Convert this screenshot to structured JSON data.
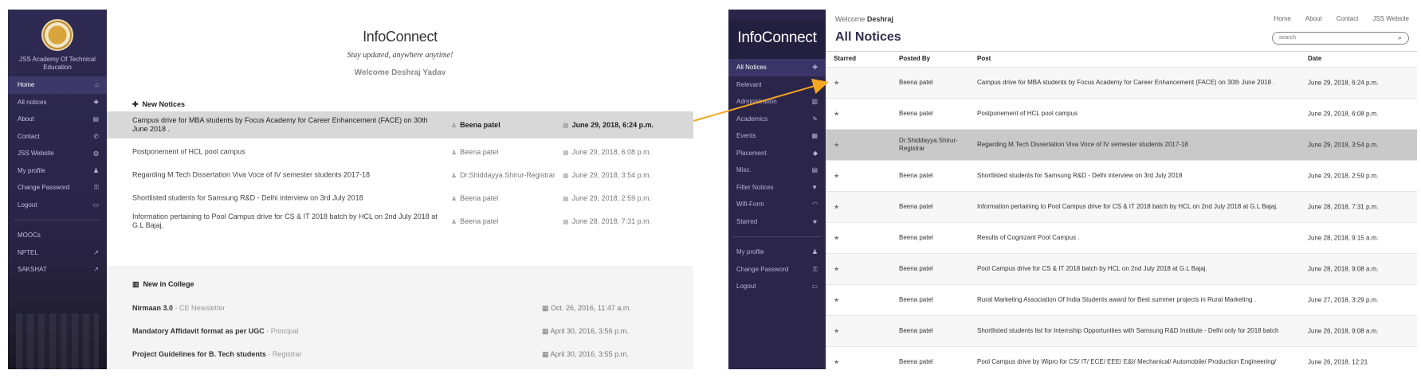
{
  "left": {
    "college_name": "JSS Academy Of Technical Education",
    "nav": [
      {
        "label": "Home",
        "icon": "home-icon",
        "glyph": "⌂",
        "active": true
      },
      {
        "label": "All notices",
        "icon": "pin-icon",
        "glyph": "✚",
        "active": false
      },
      {
        "label": "About",
        "icon": "card-icon",
        "glyph": "▤",
        "active": false
      },
      {
        "label": "Contact",
        "icon": "phone-icon",
        "glyph": "✆",
        "active": false
      },
      {
        "label": "JSS Website",
        "icon": "globe-icon",
        "glyph": "◍",
        "active": false
      },
      {
        "label": "My profile",
        "icon": "user-icon",
        "glyph": "♟",
        "active": false
      },
      {
        "label": "Change Password",
        "icon": "key-icon",
        "glyph": "⚿",
        "active": false
      },
      {
        "label": "Logout",
        "icon": "inbox-icon",
        "glyph": "▭",
        "active": false
      }
    ],
    "nav_ext": [
      {
        "label": "MOOCs",
        "icon": "",
        "glyph": ""
      },
      {
        "label": "NPTEL",
        "icon": "external-link-icon",
        "glyph": "↗"
      },
      {
        "label": "SAKSHAT",
        "icon": "external-link-icon",
        "glyph": "↗"
      }
    ],
    "brand": "InfoConnect",
    "tagline": "Stay updated, anywhere anytime!",
    "welcome": "Welcome Deshraj Yadav",
    "new_notices_title": "New Notices",
    "notices": [
      {
        "post": "Campus drive for MBA students by Focus Academy for Career Enhancement (FACE) on 30th June 2018 .",
        "by": "Beena patel",
        "date": "June 29, 2018, 6:24 p.m.",
        "highlight": true
      },
      {
        "post": "Postponement of HCL pool campus",
        "by": "Beena patel",
        "date": "June 29, 2018, 6:08 p.m.",
        "highlight": false
      },
      {
        "post": "Regarding M.Tech Dissertation Viva Voce of IV semester students 2017-18",
        "by": "Dr.Shiddayya.Shirur-Registrar",
        "date": "June 29, 2018, 3:54 p.m.",
        "highlight": false
      },
      {
        "post": "Shortlisted students for Samsung R&D - Delhi interview on 3rd July 2018",
        "by": "Beena patel",
        "date": "June 29, 2018, 2:59 p.m.",
        "highlight": false
      },
      {
        "post": "Information pertaining to Pool Campus drive for CS & IT 2018 batch by HCL on 2nd July 2018 at G.L Bajaj.",
        "by": "Beena patel",
        "date": "June 28, 2018, 7:31 p.m.",
        "highlight": false
      }
    ],
    "college_title": "New in College",
    "college_items": [
      {
        "title": "Nirmaan 3.0",
        "sep": " - ",
        "source": "CE Newsletter",
        "date": "Oct. 26, 2016, 11:47 a.m."
      },
      {
        "title": "Mandatory Affidavit format as per UGC",
        "sep": " - ",
        "source": "Principal",
        "date": "April 30, 2016, 3:56 p.m."
      },
      {
        "title": "Project Guidelines for B. Tech students",
        "sep": " - ",
        "source": "Registrar",
        "date": "April 30, 2016, 3:55 p.m."
      }
    ]
  },
  "right": {
    "brand": "InfoConnect",
    "nav": [
      {
        "label": "All Notices",
        "icon": "pin-icon",
        "glyph": "✚",
        "active": true
      },
      {
        "label": "Relevant",
        "icon": "tag-icon",
        "glyph": "◈",
        "active": false
      },
      {
        "label": "Administration",
        "icon": "bank-icon",
        "glyph": "▥",
        "active": false
      },
      {
        "label": "Academics",
        "icon": "edit-icon",
        "glyph": "✎",
        "active": false
      },
      {
        "label": "Events",
        "icon": "calendar-icon",
        "glyph": "▦",
        "active": false
      },
      {
        "label": "Placement",
        "icon": "graduation-cap-icon",
        "glyph": "◆",
        "active": false
      },
      {
        "label": "Misc.",
        "icon": "list-icon",
        "glyph": "▤",
        "active": false
      },
      {
        "label": "Filter Notices",
        "icon": "filter-icon",
        "glyph": "▼",
        "active": false
      },
      {
        "label": "Wifi-Form",
        "icon": "wifi-icon",
        "glyph": "◠",
        "active": false
      },
      {
        "label": "Starred",
        "icon": "star-icon",
        "glyph": "★",
        "active": false
      }
    ],
    "nav2": [
      {
        "label": "My profile",
        "icon": "user-icon",
        "glyph": "♟"
      },
      {
        "label": "Change Password",
        "icon": "key-icon",
        "glyph": "⚿"
      },
      {
        "label": "Logout",
        "icon": "inbox-icon",
        "glyph": "▭"
      }
    ],
    "welcome_prefix": "Welcome ",
    "welcome_name": "Deshraj",
    "topnav": [
      "Home",
      "About",
      "Contact",
      "JSS Website"
    ],
    "page_title": "All Notices",
    "search_placeholder": "search",
    "columns": [
      "Starred",
      "Posted By",
      "Post",
      "Date"
    ],
    "rows": [
      {
        "by": "Beena patel",
        "post": "Campus drive for MBA students by Focus Academy for Career Enhancement (FACE) on 30th June 2018 .",
        "date": "June 29, 2018, 6:24 p.m.",
        "style": "alt"
      },
      {
        "by": "Beena patel",
        "post": "Postponement of HCL pool campus",
        "date": "June 29, 2018, 6:08 p.m.",
        "style": ""
      },
      {
        "by": "Dr.Shiddayya.Shirur-Registrar",
        "post": "Regarding M.Tech Dissertation Viva Voce of IV semester students 2017-18",
        "date": "June 29, 2018, 3:54 p.m.",
        "style": "hl"
      },
      {
        "by": "Beena patel",
        "post": "Shortlisted students for Samsung R&D - Delhi interview on 3rd July 2018",
        "date": "June 29, 2018, 2:59 p.m.",
        "style": ""
      },
      {
        "by": "Beena patel",
        "post": "Information pertaining to Pool Campus drive for CS & IT 2018 batch by HCL on 2nd July 2018 at G.L Bajaj.",
        "date": "June 28, 2018, 7:31 p.m.",
        "style": "alt"
      },
      {
        "by": "Beena patel",
        "post": "Results of Cognizant Pool Campus .",
        "date": "June 28, 2018, 9:15 a.m.",
        "style": ""
      },
      {
        "by": "Beena patel",
        "post": "Pool Campus drive for CS & IT 2018 batch by HCL on 2nd July 2018 at G.L Bajaj.",
        "date": "June 28, 2018, 9:08 a.m.",
        "style": "alt"
      },
      {
        "by": "Beena patel",
        "post": "Rural Marketing Association Of India Students award for Best summer projects in Rural Marketing .",
        "date": "June 27, 2018, 3:29 p.m.",
        "style": ""
      },
      {
        "by": "Beena patel",
        "post": "Shortlisted students list for Internship Opportunities with Samsung R&D Institute - Delhi only for 2018 batch",
        "date": "June 26, 2018, 9:08 a.m.",
        "style": "alt"
      },
      {
        "by": "Beena patel",
        "post": "Pool Campus drive by Wipro for CS/ IT/ ECE/ EEE/ E&I/ Mechanical/ Automobile/ Production Engineering/",
        "date": "June 26, 2018, 12:21",
        "style": ""
      }
    ],
    "star_glyph": "★"
  },
  "colors": {
    "sidebar": "#2b2549",
    "highlight": "#d8d8d8",
    "arrow": "#f5a623"
  }
}
